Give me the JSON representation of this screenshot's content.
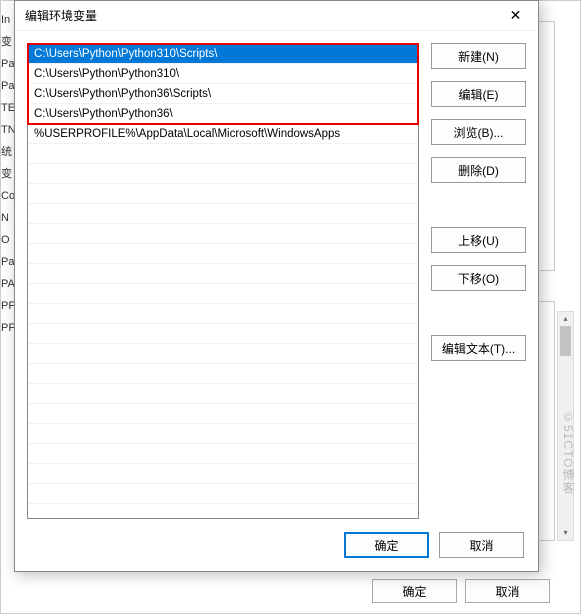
{
  "dialog": {
    "title": "编辑环境变量",
    "close_glyph": "✕",
    "list_items": [
      "C:\\Users\\Python\\Python310\\Scripts\\",
      "C:\\Users\\Python\\Python310\\",
      "C:\\Users\\Python\\Python36\\Scripts\\",
      "C:\\Users\\Python\\Python36\\",
      "%USERPROFILE%\\AppData\\Local\\Microsoft\\WindowsApps"
    ],
    "selected_index": 0,
    "highlight_count": 4,
    "buttons": {
      "new": "新建(N)",
      "edit": "编辑(E)",
      "browse": "浏览(B)...",
      "delete": "删除(D)",
      "move_up": "上移(U)",
      "move_down": "下移(O)",
      "edit_text": "编辑文本(T)..."
    },
    "footer": {
      "ok": "确定",
      "cancel": "取消"
    }
  },
  "background": {
    "left_labels": [
      "In",
      "",
      "变",
      "",
      "Pa",
      "Pa",
      "TE",
      "TN",
      "",
      "",
      "",
      "",
      "统",
      "",
      "变",
      "Co",
      "N",
      "O",
      "Pa",
      "PA",
      "PF",
      "PF"
    ],
    "footer": {
      "ok": "确定",
      "cancel": "取消"
    }
  },
  "watermark": "©51CTO博客"
}
